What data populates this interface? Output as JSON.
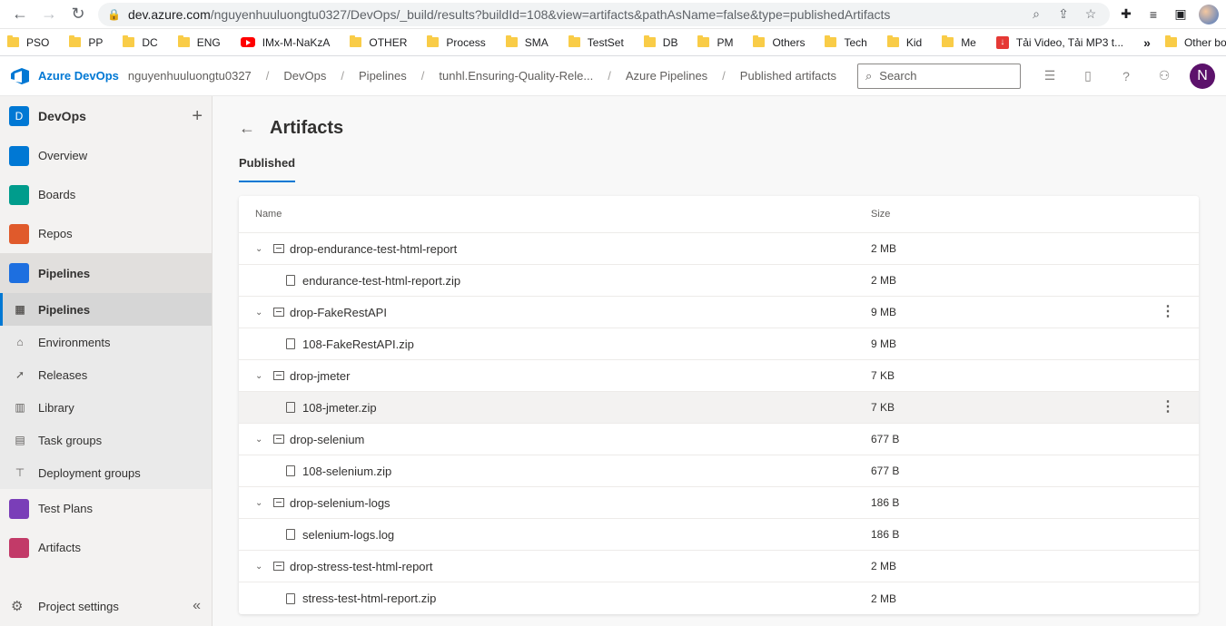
{
  "browser": {
    "url_host": "dev.azure.com",
    "url_path": "/nguyenhuuluongtu0327/DevOps/_build/results?buildId=108&view=artifacts&pathAsName=false&type=publishedArtifacts",
    "bookmarks": [
      "PSO",
      "PP",
      "DC",
      "ENG",
      "IMx-M-NaKzA",
      "OTHER",
      "Process",
      "SMA",
      "TestSet",
      "DB",
      "PM",
      "Others",
      "Tech",
      "Kid",
      "Me",
      "Tải Video, Tải MP3 t..."
    ],
    "more": "»",
    "other_bookmarks": "Other bookmarks"
  },
  "header": {
    "brand": "Azure DevOps",
    "breadcrumbs": [
      "nguyenhuuluongtu0327",
      "DevOps",
      "Pipelines",
      "tunhl.Ensuring-Quality-Rele...",
      "Azure Pipelines",
      "Published artifacts"
    ],
    "search_placeholder": "Search",
    "user_initial": "N"
  },
  "sidebar": {
    "project_initial": "D",
    "project_name": "DevOps",
    "items": [
      {
        "label": "Overview",
        "color": "#0078d4"
      },
      {
        "label": "Boards",
        "color": "#009c8c"
      },
      {
        "label": "Repos",
        "color": "#e05a2b"
      },
      {
        "label": "Pipelines",
        "color": "#1d6fe0"
      }
    ],
    "sub_items": [
      "Pipelines",
      "Environments",
      "Releases",
      "Library",
      "Task groups",
      "Deployment groups"
    ],
    "after_items": [
      {
        "label": "Test Plans",
        "color": "#7a3eb8"
      },
      {
        "label": "Artifacts",
        "color": "#c23a68"
      }
    ],
    "footer": "Project settings"
  },
  "page": {
    "title": "Artifacts",
    "tab": "Published",
    "col_name": "Name",
    "col_size": "Size",
    "rows": [
      {
        "type": "folder",
        "name": "drop-endurance-test-html-report",
        "size": "2 MB"
      },
      {
        "type": "file",
        "name": "endurance-test-html-report.zip",
        "size": "2 MB"
      },
      {
        "type": "folder",
        "name": "drop-FakeRestAPI",
        "size": "9 MB"
      },
      {
        "type": "file",
        "name": "108-FakeRestAPI.zip",
        "size": "9 MB"
      },
      {
        "type": "folder",
        "name": "drop-jmeter",
        "size": "7 KB"
      },
      {
        "type": "file",
        "name": "108-jmeter.zip",
        "size": "7 KB"
      },
      {
        "type": "folder",
        "name": "drop-selenium",
        "size": "677 B"
      },
      {
        "type": "file",
        "name": "108-selenium.zip",
        "size": "677 B"
      },
      {
        "type": "folder",
        "name": "drop-selenium-logs",
        "size": "186 B"
      },
      {
        "type": "file",
        "name": "selenium-logs.log",
        "size": "186 B"
      },
      {
        "type": "folder",
        "name": "drop-stress-test-html-report",
        "size": "2 MB"
      },
      {
        "type": "file",
        "name": "stress-test-html-report.zip",
        "size": "2 MB"
      }
    ]
  }
}
